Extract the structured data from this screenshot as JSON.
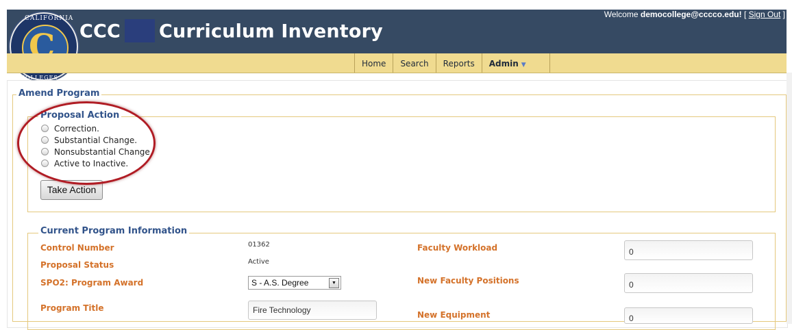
{
  "header": {
    "title_prefix": "CCC",
    "title_main": "Curriculum Inventory",
    "welcome_text": "Welcome ",
    "user_email": "democollege@cccco.edu!",
    "signout_open": " [ ",
    "signout_label": "Sign Out",
    "signout_close": " ]",
    "logo_text_top": "CALIFORNIA",
    "logo_text_bottom": "COMMUNITY COLLEGES"
  },
  "nav": {
    "items": [
      {
        "label": "Home"
      },
      {
        "label": "Search"
      },
      {
        "label": "Reports"
      },
      {
        "label": "Admin"
      }
    ]
  },
  "amend": {
    "legend": "Amend Program",
    "proposal_action": {
      "legend": "Proposal Action",
      "options": [
        {
          "label": "Correction."
        },
        {
          "label": "Substantial Change."
        },
        {
          "label": "Nonsubstantial Change."
        },
        {
          "label": "Active to Inactive."
        }
      ],
      "button_label": "Take Action"
    },
    "current_info": {
      "legend": "Current Program Information",
      "control_number_label": "Control Number",
      "control_number_value": "01362",
      "proposal_status_label": "Proposal Status",
      "proposal_status_value": "Active",
      "program_award_label": "SPO2: Program Award",
      "program_award_value": "S - A.S. Degree",
      "program_title_label": "Program Title",
      "program_title_value": "Fire Technology",
      "faculty_workload_label": "Faculty Workload",
      "faculty_workload_value": "0",
      "new_faculty_positions_label": "New Faculty Positions",
      "new_faculty_positions_value": "0",
      "new_equipment_label": "New Equipment",
      "new_equipment_value": "0"
    }
  },
  "colors": {
    "header_bg": "#364a63",
    "nav_bg": "#f0db90",
    "legend_color": "#31538a",
    "label_color": "#d4722a",
    "annotation_ring": "#b01c24"
  }
}
